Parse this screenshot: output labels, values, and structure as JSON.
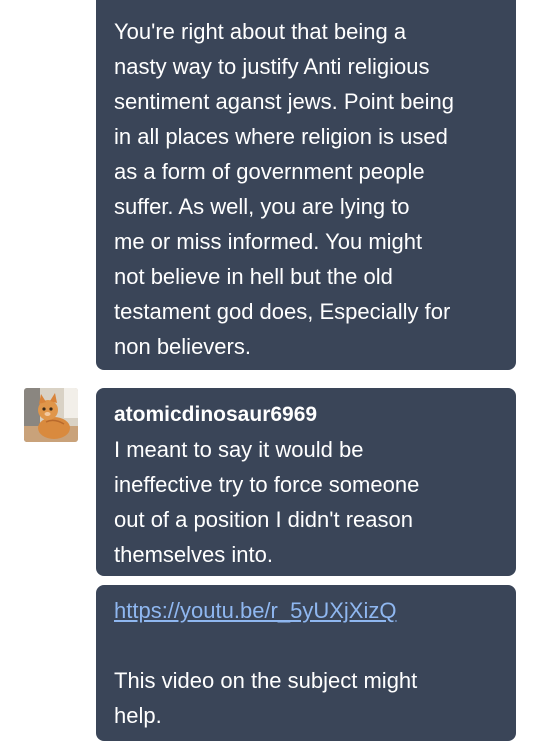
{
  "messages": [
    {
      "text": "You're right about that being a\nnasty way to justify Anti religious\nsentiment aganst jews. Point being\nin all places where religion is used\nas a form of government people\nsuffer. As well, you are lying to\nme or miss informed. You might\nnot believe in hell but the old\ntestament god does, Especially for\nnon believers."
    },
    {
      "sender": "atomicdinosaur6969",
      "text": "I meant to say it would be\nineffective try to force someone\nout of a position I didn't reason\nthemselves into."
    },
    {
      "link": "https://youtu.be/r_5yUXjXizQ",
      "text": "This video on the subject might\nhelp."
    }
  ],
  "avatar": {
    "icon": "cat-photo-icon"
  },
  "colors": {
    "bubble": "#3a4558",
    "text": "#ffffff",
    "link": "#8fb7f0",
    "background": "#ffffff"
  }
}
